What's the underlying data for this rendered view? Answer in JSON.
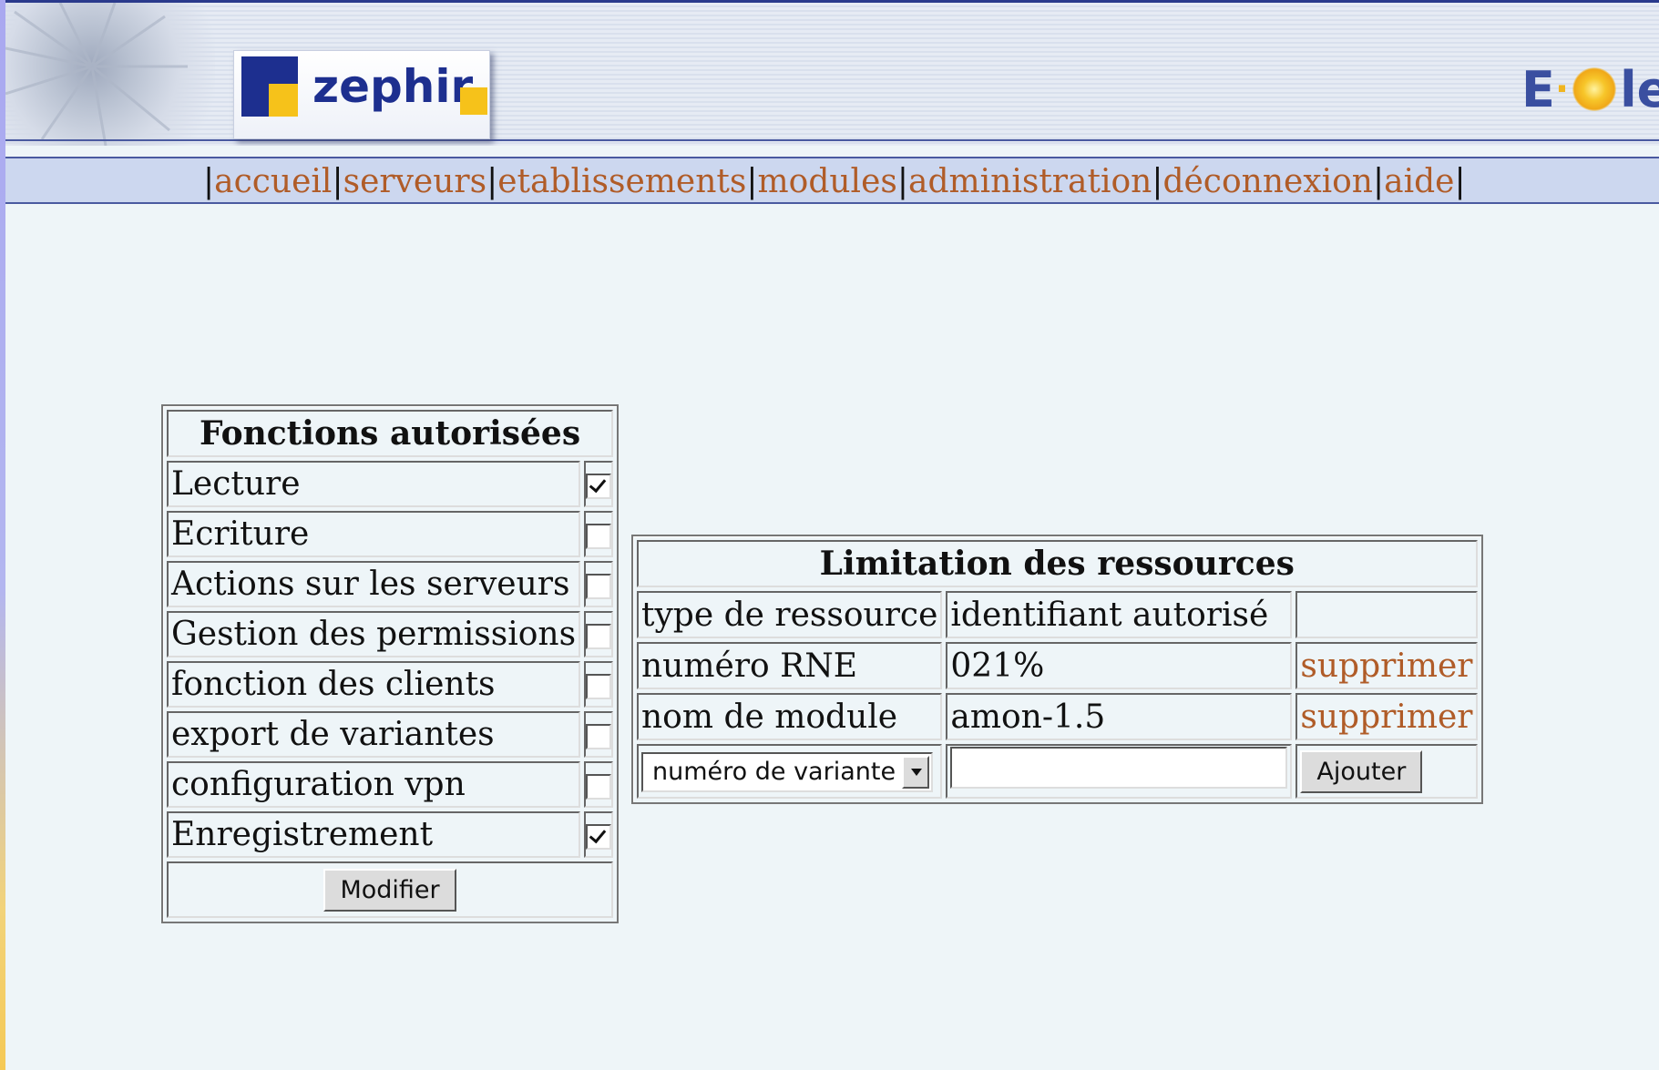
{
  "logo": {
    "text": "zephir"
  },
  "brand": {
    "left": "E",
    "right": "le",
    "dots": "·"
  },
  "nav": {
    "items": [
      "accueil",
      "serveurs",
      "etablissements",
      "modules",
      "administration",
      "déconnexion",
      "aide"
    ],
    "separator": "|"
  },
  "functions": {
    "title": "Fonctions autorisées",
    "rows": [
      {
        "label": "Lecture",
        "checked": true
      },
      {
        "label": "Ecriture",
        "checked": false
      },
      {
        "label": "Actions sur les serveurs",
        "checked": false
      },
      {
        "label": "Gestion des permissions",
        "checked": false
      },
      {
        "label": "fonction des clients",
        "checked": false
      },
      {
        "label": "export de variantes",
        "checked": false
      },
      {
        "label": "configuration vpn",
        "checked": false
      },
      {
        "label": "Enregistrement",
        "checked": true
      }
    ],
    "modify_label": "Modifier"
  },
  "resources": {
    "title": "Limitation des ressources",
    "headers": [
      "type de ressource",
      "identifiant autorisé",
      ""
    ],
    "rows": [
      {
        "type": "numéro RNE",
        "id": "021%",
        "action": "supprimer"
      },
      {
        "type": "nom de module",
        "id": "amon-1.5",
        "action": "supprimer"
      }
    ],
    "select_value": "numéro de variante",
    "input_value": "",
    "add_label": "Ajouter"
  },
  "colors": {
    "link": "#b05c28",
    "nav_bg": "#ccd7ef",
    "page_bg": "#eef5f8",
    "brand_blue": "#1d2f8f",
    "brand_yellow": "#f6c21a"
  }
}
